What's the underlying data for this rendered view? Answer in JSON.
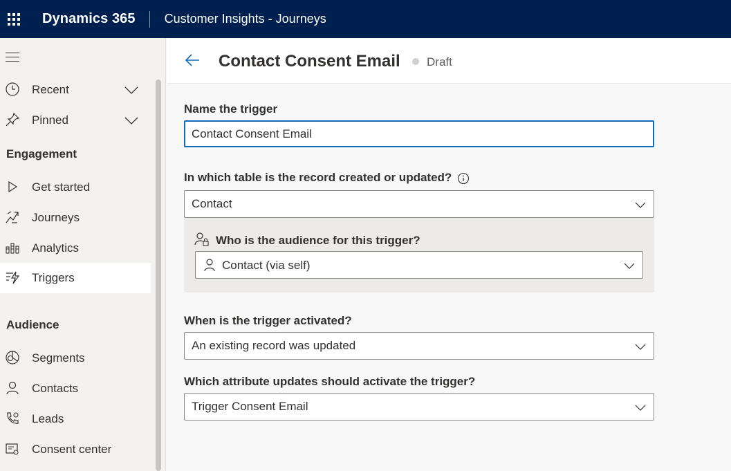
{
  "topbar": {
    "brand": "Dynamics 365",
    "app_name": "Customer Insights - Journeys"
  },
  "sidebar": {
    "items_top": [
      {
        "label": "Recent",
        "icon": "clock-icon"
      },
      {
        "label": "Pinned",
        "icon": "pin-icon"
      }
    ],
    "sections": [
      {
        "title": "Engagement",
        "items": [
          {
            "label": "Get started",
            "icon": "play-icon"
          },
          {
            "label": "Journeys",
            "icon": "journeys-icon"
          },
          {
            "label": "Analytics",
            "icon": "analytics-icon"
          },
          {
            "label": "Triggers",
            "icon": "trigger-icon",
            "active": true
          }
        ]
      },
      {
        "title": "Audience",
        "items": [
          {
            "label": "Segments",
            "icon": "segments-icon"
          },
          {
            "label": "Contacts",
            "icon": "person-icon"
          },
          {
            "label": "Leads",
            "icon": "leads-icon"
          },
          {
            "label": "Consent center",
            "icon": "consent-icon"
          }
        ]
      }
    ]
  },
  "header": {
    "title": "Contact Consent Email",
    "status": "Draft"
  },
  "form": {
    "name_label": "Name the trigger",
    "name_value": "Contact Consent Email",
    "table_label": "In which table is the record created or updated?",
    "table_value": "Contact",
    "audience_label": "Who is the audience for this trigger?",
    "audience_value": "Contact (via self)",
    "activation_label": "When is the trigger activated?",
    "activation_value": "An existing record was updated",
    "attribute_label": "Which attribute updates should activate the trigger?",
    "attribute_value": "Trigger Consent Email"
  },
  "colors": {
    "topbar": "#002050",
    "accent": "#0f6cbd",
    "sidebar": "#f3f2f1"
  }
}
